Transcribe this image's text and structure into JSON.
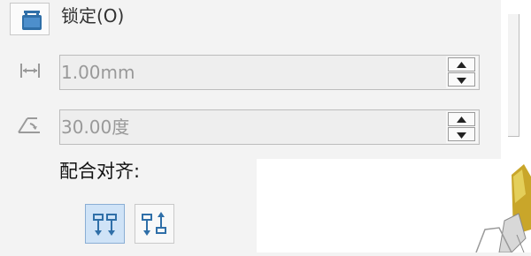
{
  "lock": {
    "label": "锁定(O)",
    "icon": "lock-icon"
  },
  "distance": {
    "icon": "distance-icon",
    "value": "1.00mm"
  },
  "angle": {
    "icon": "angle-icon",
    "value": "30.00度"
  },
  "alignment": {
    "label": "配合对齐:",
    "options": [
      {
        "icon": "aligned-icon",
        "selected": true
      },
      {
        "icon": "anti-aligned-icon",
        "selected": false
      }
    ]
  },
  "colors": {
    "panel_bg": "#f3f3f3",
    "field_bg": "#eeeeee",
    "field_text": "#999999",
    "icon_blue": "#2f6fa8",
    "selected_bg": "#cfe3f7",
    "part_yellow": "#c9a62a"
  }
}
